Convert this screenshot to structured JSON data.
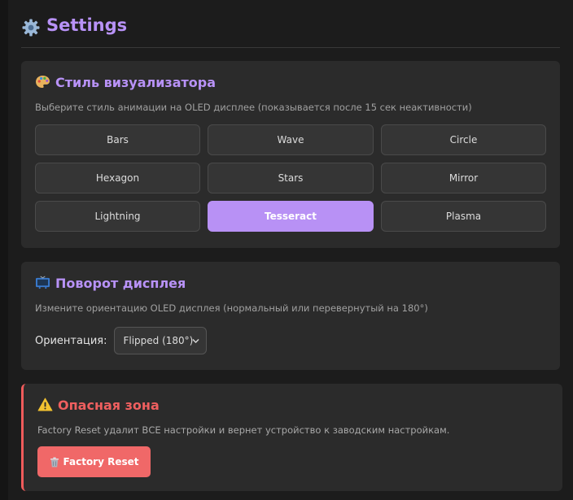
{
  "header": {
    "title": "Settings",
    "icon": "gear-icon"
  },
  "visualizer": {
    "title": "Стиль визуализатора",
    "icon": "palette-icon",
    "description": "Выберите стиль анимации на OLED дисплее (показывается после 15 сек неактивности)",
    "styles": [
      {
        "label": "Bars",
        "active": false
      },
      {
        "label": "Wave",
        "active": false
      },
      {
        "label": "Circle",
        "active": false
      },
      {
        "label": "Hexagon",
        "active": false
      },
      {
        "label": "Stars",
        "active": false
      },
      {
        "label": "Mirror",
        "active": false
      },
      {
        "label": "Lightning",
        "active": false
      },
      {
        "label": "Tesseract",
        "active": true
      },
      {
        "label": "Plasma",
        "active": false
      }
    ]
  },
  "rotation": {
    "title": "Поворот дисплея",
    "icon": "tv-icon",
    "description": "Измените ориентацию OLED дисплея (нормальный или перевернутый на 180°)",
    "orientation_label": "Ориентация:",
    "orientation_value": "Flipped (180°)"
  },
  "danger": {
    "title": "Опасная зона",
    "icon": "warning-icon",
    "description": "Factory Reset удалит ВСЕ настройки и вернет устройство к заводским настройкам.",
    "reset_label": "Factory Reset",
    "reset_icon": "trash-icon"
  },
  "colors": {
    "accent": "#b892f7",
    "danger": "#ef5f5f",
    "background": "#1c1c1c",
    "card": "#2b2b2b"
  }
}
